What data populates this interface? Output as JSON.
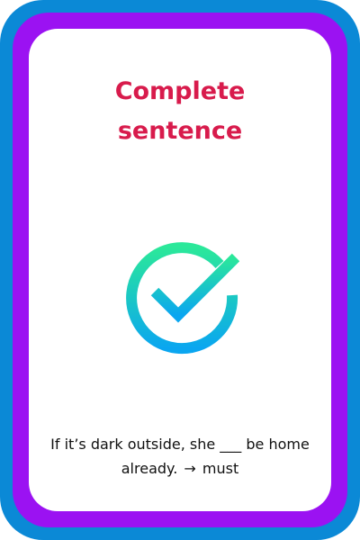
{
  "card": {
    "title": "Complete\nsentence",
    "icon": "checkmark-circle-icon",
    "sentence": {
      "text": "If it’s dark outside, she ___ be home already.",
      "arrow": "→",
      "answer": "must"
    }
  },
  "colors": {
    "outer_frame": "#0b89d6",
    "inner_frame": "#9b12f2",
    "card_background": "#ffffff",
    "title": "#d81b4c",
    "icon_gradient_top": "#2be89a",
    "icon_gradient_bottom": "#0aa6f0",
    "text": "#111111"
  }
}
